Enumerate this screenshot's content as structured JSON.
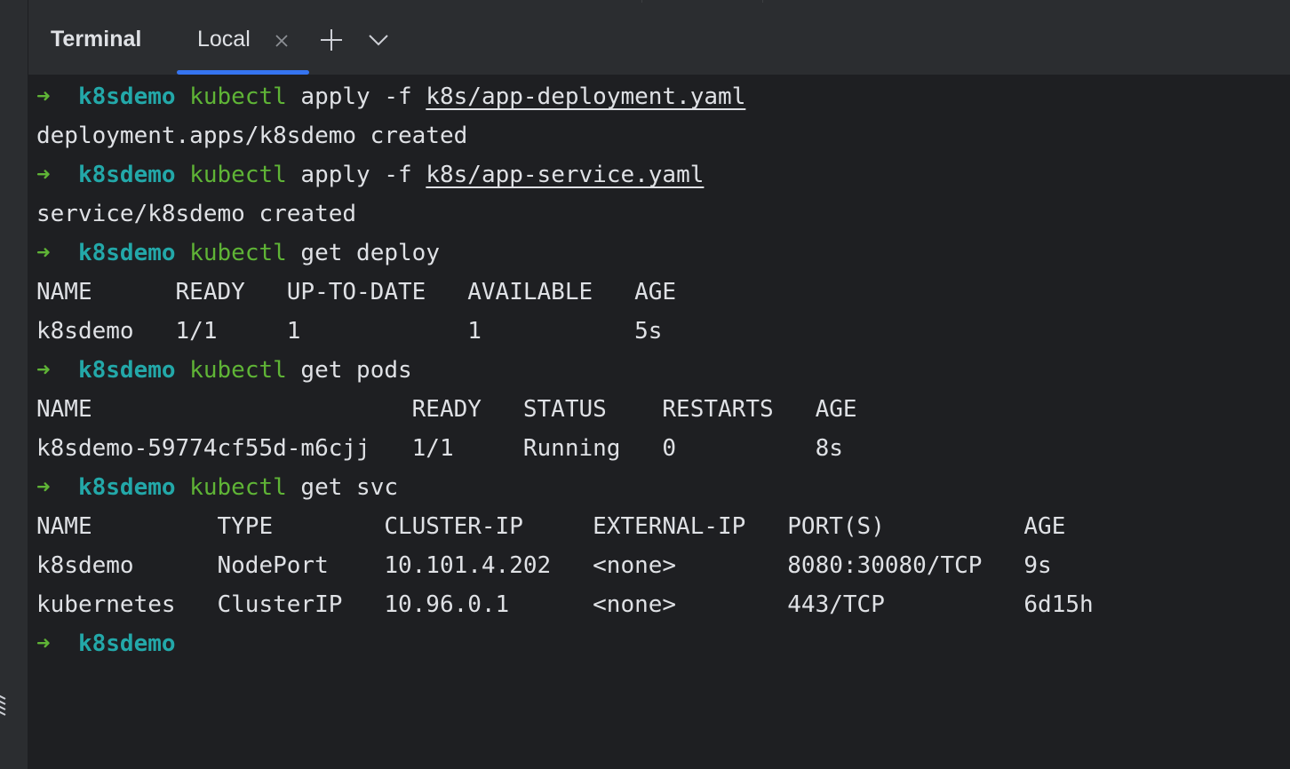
{
  "tool_window": {
    "title": "Terminal",
    "tabs": [
      {
        "label": "Local",
        "active": true
      }
    ],
    "new_tab_icon": "plus-icon",
    "dropdown_icon": "chevron-down-icon",
    "close_icon": "close-icon"
  },
  "colors": {
    "accent": "#3574f0",
    "prompt_arrow": "#5fb436",
    "prompt_dir": "#23a8a9",
    "command": "#5fb436",
    "text": "#dfe1e5",
    "background": "#1e1f22",
    "toolbar": "#2b2d30"
  },
  "terminal": {
    "prompt_arrow": "➜",
    "prompt_dir": "k8sdemo",
    "lines": [
      {
        "type": "prompt",
        "cmd": "kubectl",
        "args": " apply -f ",
        "path": "k8s/app-deployment.yaml"
      },
      {
        "type": "output",
        "text": "deployment.apps/k8sdemo created"
      },
      {
        "type": "prompt",
        "cmd": "kubectl",
        "args": " apply -f ",
        "path": "k8s/app-service.yaml"
      },
      {
        "type": "output",
        "text": "service/k8sdemo created"
      },
      {
        "type": "prompt",
        "cmd": "kubectl",
        "args": " get deploy",
        "path": ""
      },
      {
        "type": "output",
        "text": "NAME      READY   UP-TO-DATE   AVAILABLE   AGE"
      },
      {
        "type": "output",
        "text": "k8sdemo   1/1     1            1           5s"
      },
      {
        "type": "prompt",
        "cmd": "kubectl",
        "args": " get pods",
        "path": ""
      },
      {
        "type": "output",
        "text": "NAME                       READY   STATUS    RESTARTS   AGE"
      },
      {
        "type": "output",
        "text": "k8sdemo-59774cf55d-m6cjj   1/1     Running   0          8s"
      },
      {
        "type": "prompt",
        "cmd": "kubectl",
        "args": " get svc",
        "path": ""
      },
      {
        "type": "output",
        "text": "NAME         TYPE        CLUSTER-IP     EXTERNAL-IP   PORT(S)          AGE"
      },
      {
        "type": "output",
        "text": "k8sdemo      NodePort    10.101.4.202   <none>        8080:30080/TCP   9s"
      },
      {
        "type": "output",
        "text": "kubernetes   ClusterIP   10.96.0.1      <none>        443/TCP          6d15h"
      },
      {
        "type": "prompt",
        "cmd": "",
        "args": "",
        "path": ""
      }
    ]
  }
}
